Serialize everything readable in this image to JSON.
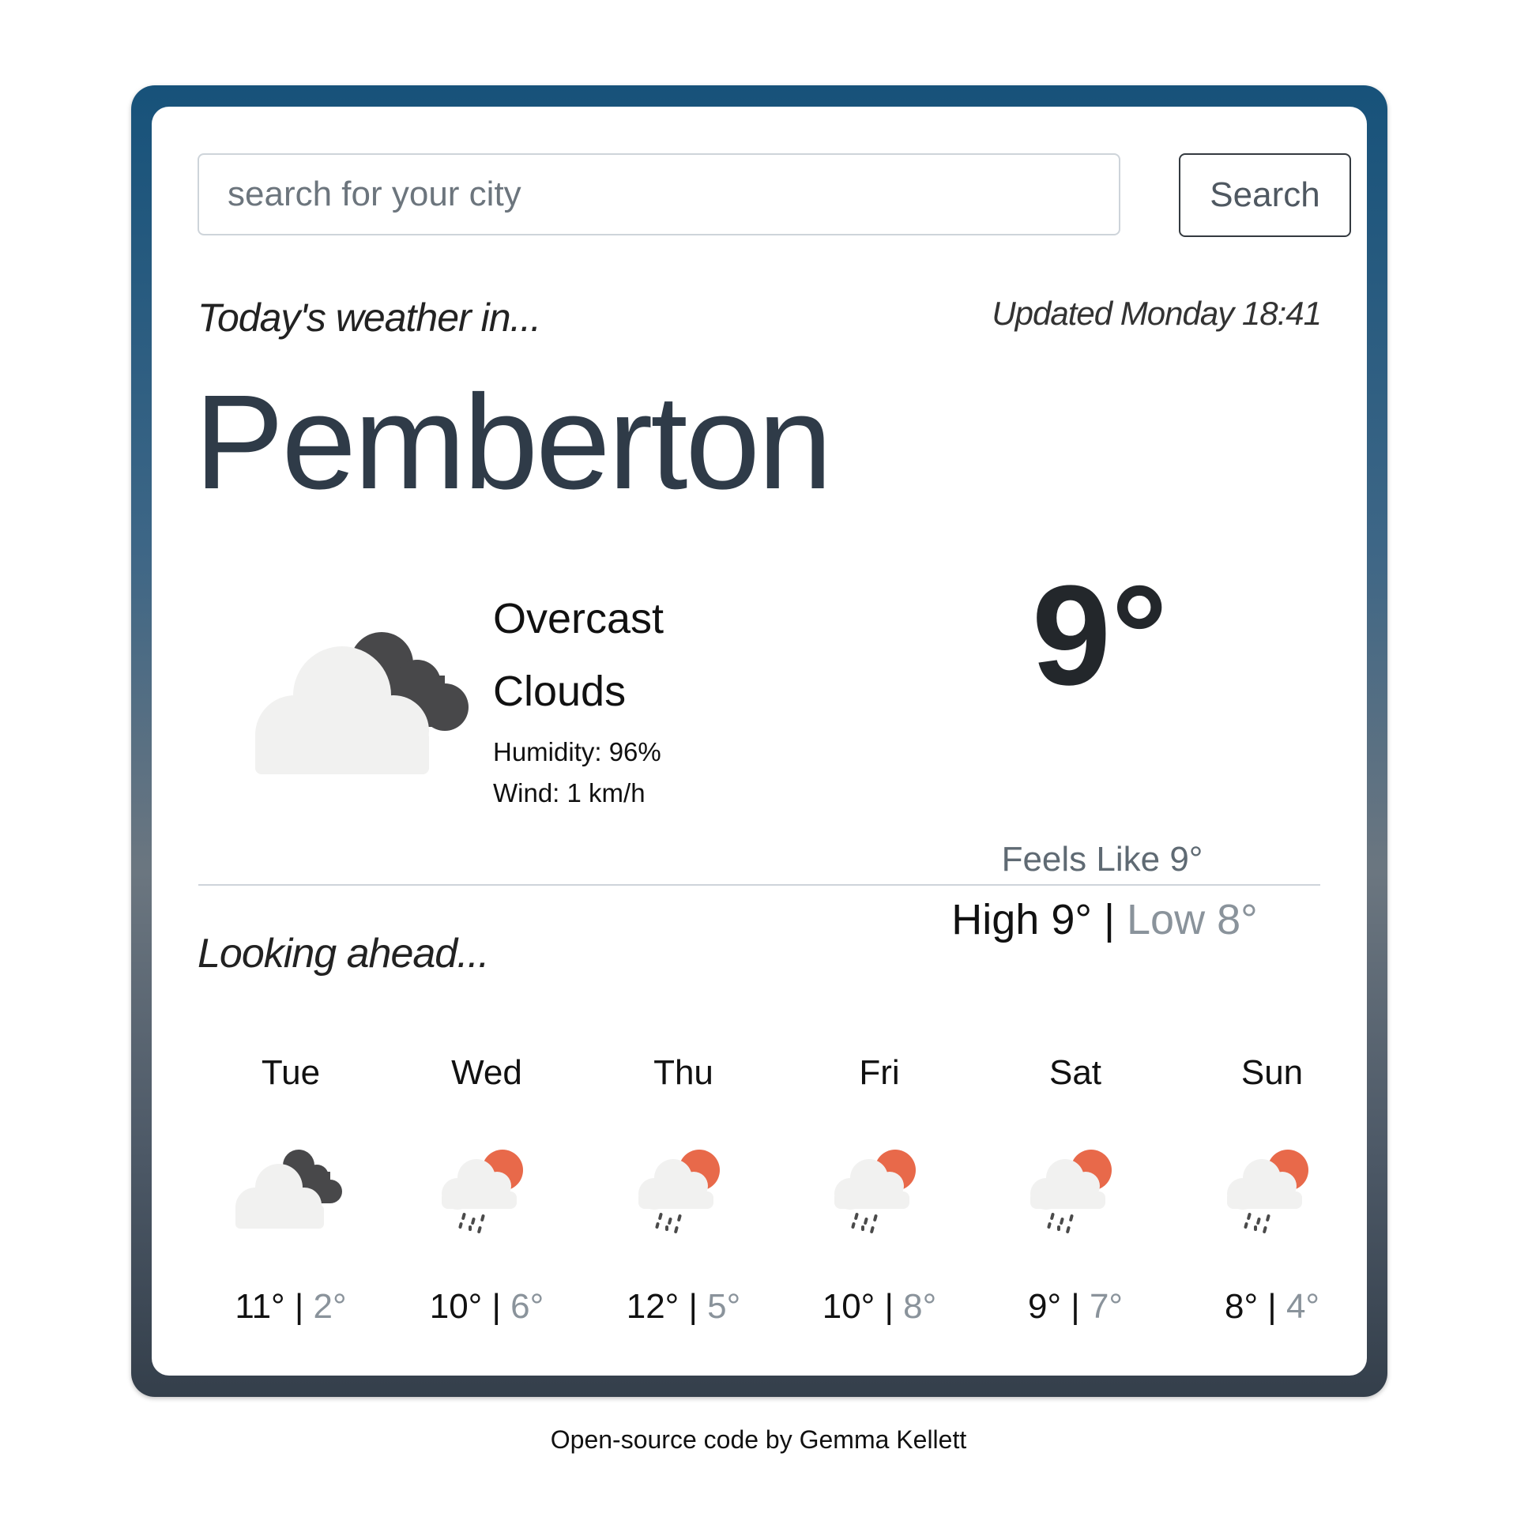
{
  "search": {
    "placeholder": "search for your city",
    "value": "",
    "button_label": "Search"
  },
  "today": {
    "label": "Today's weather in...",
    "updated": "Updated Monday 18:41",
    "city": "Pemberton",
    "icon": "overcast-clouds-icon",
    "description_line1": "Overcast",
    "description_line2": "Clouds",
    "humidity": "Humidity: 96%",
    "wind": "Wind: 1 km/h",
    "temperature": "9°",
    "feels_like": "Feels Like 9°",
    "high": "High 9°",
    "separator": " | ",
    "low": "Low 8°"
  },
  "forecast": {
    "label": "Looking ahead...",
    "days": [
      {
        "day": "Tue",
        "icon": "overcast-clouds-icon",
        "high": "11°",
        "low": "2°"
      },
      {
        "day": "Wed",
        "icon": "rain-partly-sunny-icon",
        "high": "10°",
        "low": "6°"
      },
      {
        "day": "Thu",
        "icon": "rain-partly-sunny-icon",
        "high": "12°",
        "low": "5°"
      },
      {
        "day": "Fri",
        "icon": "rain-partly-sunny-icon",
        "high": "10°",
        "low": "8°"
      },
      {
        "day": "Sat",
        "icon": "rain-partly-sunny-icon",
        "high": "9°",
        "low": "7°"
      },
      {
        "day": "Sun",
        "icon": "rain-partly-sunny-icon",
        "high": "8°",
        "low": "4°"
      }
    ],
    "separator": " | "
  },
  "colors": {
    "frame_top": "#17527a",
    "frame_mid": "#6b7680",
    "frame_bottom": "#343f4b",
    "sun": "#e8694a",
    "cloud_light": "#f1f1f0",
    "cloud_dark": "#48484a"
  },
  "footer": {
    "text": "Open-source code by Gemma Kellett"
  }
}
